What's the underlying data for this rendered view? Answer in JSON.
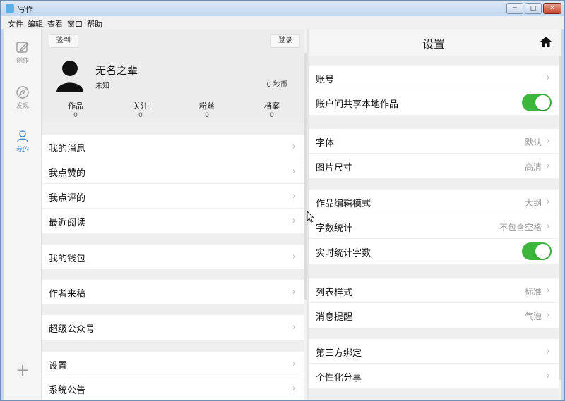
{
  "window": {
    "title": "写作",
    "min_glyph": "─",
    "max_glyph": "□",
    "close_glyph": "✕"
  },
  "menu": [
    "文件",
    "编辑",
    "查看",
    "窗口",
    "帮助"
  ],
  "rail": [
    {
      "label": "创作",
      "icon": "edit-icon"
    },
    {
      "label": "发现",
      "icon": "compass-icon"
    },
    {
      "label": "我的",
      "icon": "user-icon",
      "active": true
    }
  ],
  "rail_add_glyph": "+",
  "profile": {
    "signin_label": "签到",
    "login_label": "登录",
    "name": "无名之辈",
    "subtitle": "未知",
    "time": "0 秒币",
    "stats": [
      {
        "label": "作品",
        "value": "0"
      },
      {
        "label": "关注",
        "value": "0"
      },
      {
        "label": "粉丝",
        "value": "0"
      },
      {
        "label": "档案",
        "value": "0"
      }
    ]
  },
  "chevron": "›",
  "left_groups": [
    [
      "我的消息",
      "我点赞的",
      "我点评的",
      "最近阅读"
    ],
    [
      "我的钱包"
    ],
    [
      "作者来稿"
    ],
    [
      "超级公众号"
    ],
    [
      "设置",
      "系统公告"
    ]
  ],
  "settings": {
    "title": "设置",
    "groups": [
      [
        {
          "label": "账号",
          "type": "chevron"
        },
        {
          "label": "账户间共享本地作品",
          "type": "toggle",
          "on": true
        }
      ],
      [
        {
          "label": "字体",
          "type": "value",
          "value": "默认"
        },
        {
          "label": "图片尺寸",
          "type": "value",
          "value": "高清"
        }
      ],
      [
        {
          "label": "作品编辑模式",
          "type": "value",
          "value": "大纲"
        },
        {
          "label": "字数统计",
          "type": "value",
          "value": "不包含空格"
        },
        {
          "label": "实时统计字数",
          "type": "toggle",
          "on": true
        }
      ],
      [
        {
          "label": "列表样式",
          "type": "value",
          "value": "标准"
        },
        {
          "label": "消息提醒",
          "type": "value",
          "value": "气泡"
        }
      ],
      [
        {
          "label": "第三方绑定",
          "type": "chevron"
        },
        {
          "label": "个性化分享",
          "type": "chevron"
        }
      ]
    ]
  },
  "colors": {
    "accent": "#3b8fe0",
    "toggle_on": "#3cb73c"
  }
}
